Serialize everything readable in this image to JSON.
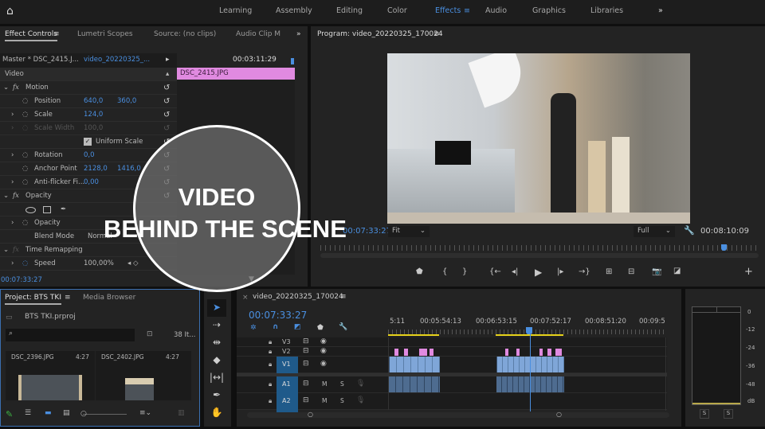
{
  "workspaces": [
    "Learning",
    "Assembly",
    "Editing",
    "Color",
    "Effects",
    "Audio",
    "Graphics",
    "Libraries"
  ],
  "active_workspace": "Effects",
  "effect_panel": {
    "tabs": [
      "Effect Controls",
      "Lumetri Scopes",
      "Source: (no clips)",
      "Audio Clip Mix"
    ],
    "master": "Master * DSC_2415.J...",
    "sequence": "video_20220325_...",
    "timecode": "00:03:11:29",
    "clip": "DSC_2415.JPG",
    "section": "Video",
    "rows": [
      {
        "label": "Motion",
        "fx": true
      },
      {
        "label": "Position",
        "v1": "640,0",
        "v2": "360,0"
      },
      {
        "label": "Scale",
        "v1": "124,0"
      },
      {
        "label": "Scale Width",
        "v1": "100,0",
        "disabled": true
      },
      {
        "label": "Uniform Scale",
        "checkbox": true
      },
      {
        "label": "Rotation",
        "v1": "0,0"
      },
      {
        "label": "Anchor Point",
        "v1": "2128,0",
        "v2": "1416,0"
      },
      {
        "label": "Anti-flicker Fi...",
        "v1": "0,00"
      },
      {
        "label": "Opacity",
        "fx": true
      },
      {
        "label": "Opacity"
      },
      {
        "label": "Blend Mode",
        "v1": "Normal"
      },
      {
        "label": "Time Remapping",
        "fx": true
      },
      {
        "label": "Speed",
        "v1": "100,00%"
      }
    ],
    "footer_time": "00:07:33:27"
  },
  "program": {
    "title": "Program: video_20220325_170024",
    "timecode": "00:07:33:27",
    "fit": "Fit",
    "quality": "Full",
    "duration": "00:08:10:09",
    "playhead": 0.92
  },
  "project": {
    "tabs": [
      "Project: BTS TKI",
      "Media Browser"
    ],
    "file": "BTS TKI.prproj",
    "count": "38 It...",
    "search_placeholder": "",
    "items": [
      {
        "name": "DSC_2396.JPG",
        "dur": "4:27"
      },
      {
        "name": "DSC_2402.JPG",
        "dur": "4:27"
      }
    ]
  },
  "timeline": {
    "name": "video_20220325_170024",
    "timecode": "00:07:33:27",
    "ruler": [
      "5:11",
      "00:05:54:13",
      "00:06:53:15",
      "00:07:52:17",
      "00:08:51:20",
      "00:09:5("
    ],
    "tracks": [
      "V3",
      "V2",
      "V1",
      "A1",
      "A2"
    ],
    "m": "M",
    "s": "S"
  },
  "meter": {
    "scale": [
      "0",
      "-12",
      "-24",
      "-36",
      "-48",
      "dB"
    ],
    "solo": [
      "S",
      "S"
    ]
  },
  "overlay": {
    "line1": "VIDEO",
    "line2": "BEHIND THE SCENE"
  },
  "colors": {
    "accent": "#4a8fe0",
    "clip_video": "#7fa6d8",
    "clip_still": "#e08ae0",
    "inout": "#e6d21a"
  }
}
